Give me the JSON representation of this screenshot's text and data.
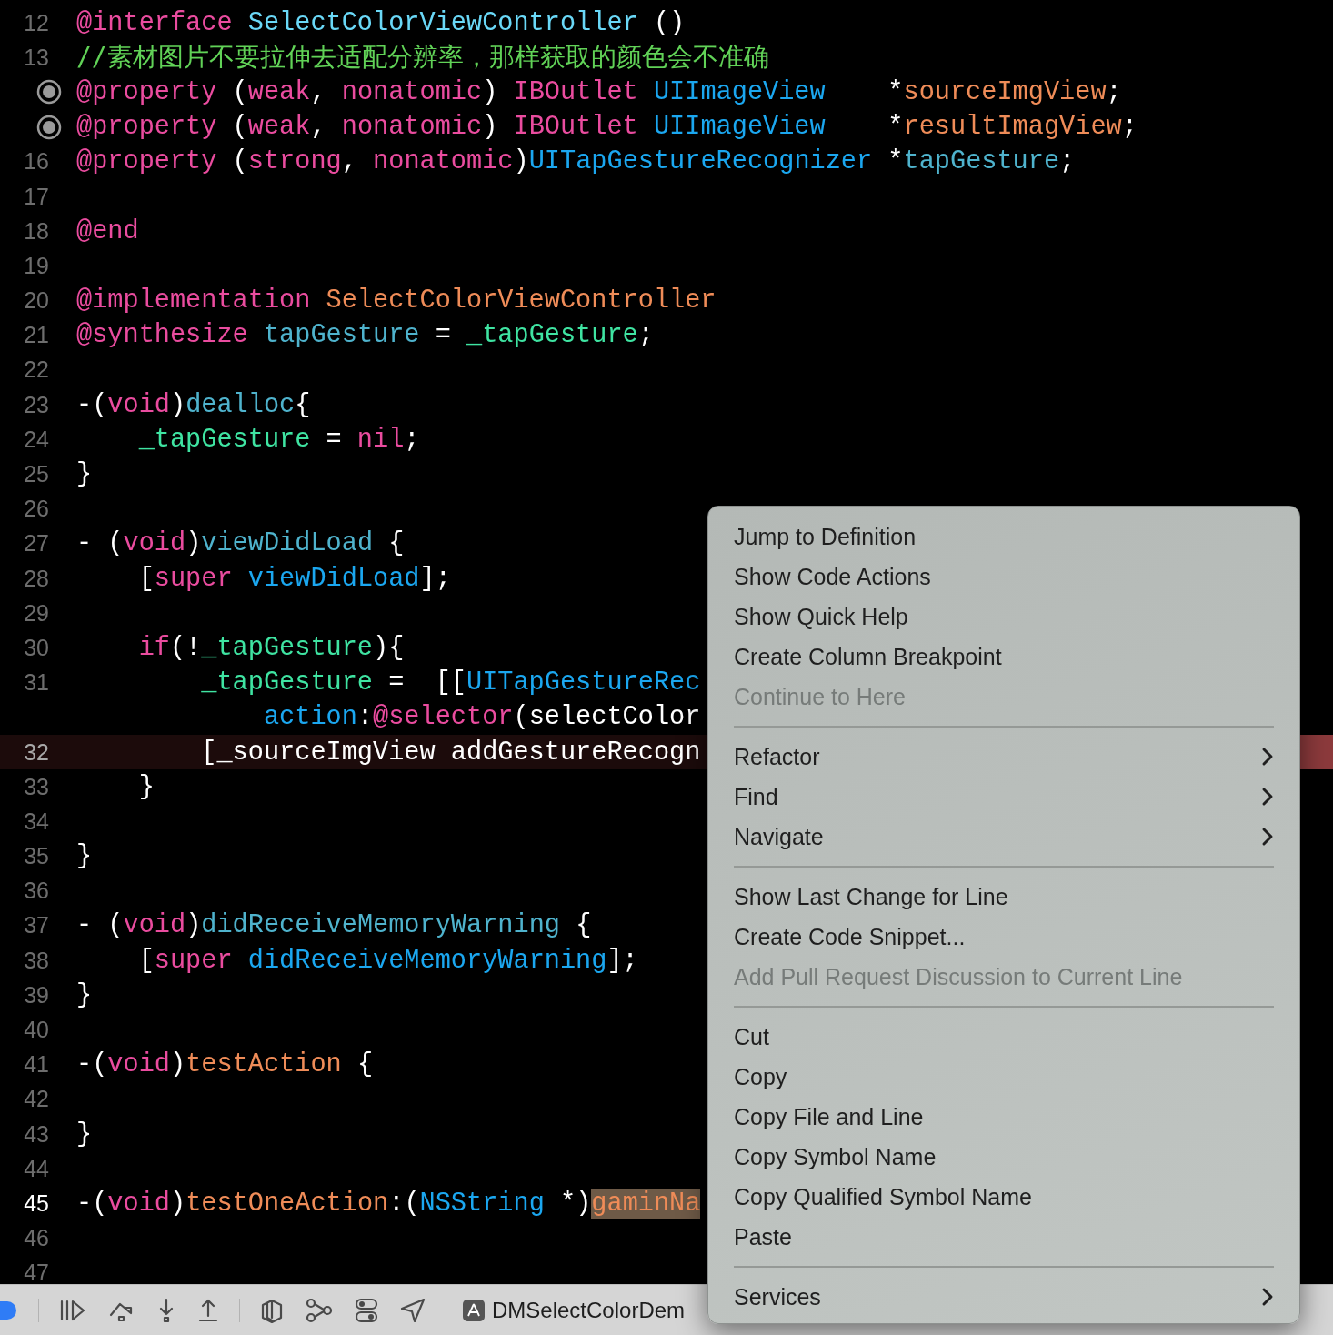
{
  "editor": {
    "lines": [
      {
        "number": "12",
        "kind": "normal",
        "tokens": [
          {
            "text": "@interface ",
            "kind": "kw"
          },
          {
            "text": "SelectColorViewController",
            "kind": "cls"
          },
          {
            "text": " ()",
            "kind": "plain"
          }
        ]
      },
      {
        "number": "13",
        "kind": "normal",
        "tokens": [
          {
            "text": "//素材图片不要拉伸去适配分辨率，那样获取的颜色会不准确",
            "kind": "comment"
          }
        ]
      },
      {
        "kind": "outlet",
        "tokens": [
          {
            "text": "@property",
            "kind": "kw"
          },
          {
            "text": " (",
            "kind": "plain"
          },
          {
            "text": "weak",
            "kind": "kw"
          },
          {
            "text": ", ",
            "kind": "plain"
          },
          {
            "text": "nonatomic",
            "kind": "kw"
          },
          {
            "text": ") ",
            "kind": "plain"
          },
          {
            "text": "IBOutlet ",
            "kind": "kw"
          },
          {
            "text": "UIImageView",
            "kind": "type"
          },
          {
            "text": "    *",
            "kind": "plain"
          },
          {
            "text": "sourceImgView",
            "kind": "decl"
          },
          {
            "text": ";",
            "kind": "plain"
          }
        ]
      },
      {
        "kind": "outlet",
        "tokens": [
          {
            "text": "@property",
            "kind": "kw"
          },
          {
            "text": " (",
            "kind": "plain"
          },
          {
            "text": "weak",
            "kind": "kw"
          },
          {
            "text": ", ",
            "kind": "plain"
          },
          {
            "text": "nonatomic",
            "kind": "kw"
          },
          {
            "text": ") ",
            "kind": "plain"
          },
          {
            "text": "IBOutlet ",
            "kind": "kw"
          },
          {
            "text": "UIImageView",
            "kind": "type"
          },
          {
            "text": "    *",
            "kind": "plain"
          },
          {
            "text": "resultImagView",
            "kind": "decl"
          },
          {
            "text": ";",
            "kind": "plain"
          }
        ]
      },
      {
        "number": "16",
        "kind": "normal",
        "tokens": [
          {
            "text": "@property",
            "kind": "kw"
          },
          {
            "text": " (",
            "kind": "plain"
          },
          {
            "text": "strong",
            "kind": "kw"
          },
          {
            "text": ", ",
            "kind": "plain"
          },
          {
            "text": "nonatomic",
            "kind": "kw"
          },
          {
            "text": ")",
            "kind": "plain"
          },
          {
            "text": "UITapGestureRecognizer",
            "kind": "type"
          },
          {
            "text": " *",
            "kind": "plain"
          },
          {
            "text": "tapGesture",
            "kind": "prop"
          },
          {
            "text": ";",
            "kind": "plain"
          }
        ]
      },
      {
        "number": "17",
        "kind": "normal"
      },
      {
        "number": "18",
        "kind": "normal",
        "tokens": [
          {
            "text": "@end",
            "kind": "kw"
          }
        ]
      },
      {
        "number": "19",
        "kind": "normal"
      },
      {
        "number": "20",
        "kind": "normal",
        "tokens": [
          {
            "text": "@implementation ",
            "kind": "kw"
          },
          {
            "text": "SelectColorViewController",
            "kind": "decl"
          }
        ]
      },
      {
        "number": "21",
        "kind": "normal",
        "tokens": [
          {
            "text": "@synthesize ",
            "kind": "kw"
          },
          {
            "text": "tapGesture",
            "kind": "prop"
          },
          {
            "text": " = ",
            "kind": "plain"
          },
          {
            "text": "_tapGesture",
            "kind": "ivar"
          },
          {
            "text": ";",
            "kind": "plain"
          }
        ]
      },
      {
        "number": "22",
        "kind": "normal"
      },
      {
        "number": "23",
        "kind": "normal",
        "tokens": [
          {
            "text": "-(",
            "kind": "plain"
          },
          {
            "text": "void",
            "kind": "kw"
          },
          {
            "text": ")",
            "kind": "plain"
          },
          {
            "text": "dealloc",
            "kind": "prop"
          },
          {
            "text": "{",
            "kind": "plain"
          }
        ]
      },
      {
        "number": "24",
        "kind": "normal",
        "tokens": [
          {
            "text": "    _tapGesture",
            "kind": "ivar"
          },
          {
            "text": " = ",
            "kind": "plain"
          },
          {
            "text": "nil",
            "kind": "kw"
          },
          {
            "text": ";",
            "kind": "plain"
          }
        ]
      },
      {
        "number": "25",
        "kind": "normal",
        "tokens": [
          {
            "text": "}",
            "kind": "plain"
          }
        ]
      },
      {
        "number": "26",
        "kind": "normal"
      },
      {
        "number": "27",
        "kind": "normal",
        "tokens": [
          {
            "text": "- (",
            "kind": "plain"
          },
          {
            "text": "void",
            "kind": "kw"
          },
          {
            "text": ")",
            "kind": "plain"
          },
          {
            "text": "viewDidLoad",
            "kind": "prop"
          },
          {
            "text": " {",
            "kind": "plain"
          }
        ]
      },
      {
        "number": "28",
        "kind": "normal",
        "tokens": [
          {
            "text": "    [",
            "kind": "plain"
          },
          {
            "text": "super ",
            "kind": "kw"
          },
          {
            "text": "viewDidLoad",
            "kind": "type"
          },
          {
            "text": "];",
            "kind": "plain"
          }
        ]
      },
      {
        "number": "29",
        "kind": "normal"
      },
      {
        "number": "30",
        "kind": "normal",
        "tokens": [
          {
            "text": "    if",
            "kind": "kw"
          },
          {
            "text": "(!",
            "kind": "plain"
          },
          {
            "text": "_tapGesture",
            "kind": "ivar"
          },
          {
            "text": "){",
            "kind": "plain"
          }
        ]
      },
      {
        "number": "31",
        "kind": "normal",
        "tokens": [
          {
            "text": "        _tapGesture",
            "kind": "ivar"
          },
          {
            "text": " =  [[",
            "kind": "plain"
          },
          {
            "text": "UITapGestureRec",
            "kind": "type"
          }
        ]
      },
      {
        "kind": "wrap",
        "tokens": [
          {
            "text": "            action",
            "kind": "type"
          },
          {
            "text": ":",
            "kind": "plain"
          },
          {
            "text": "@selector",
            "kind": "kw"
          },
          {
            "text": "(selectColor",
            "kind": "plain"
          }
        ]
      },
      {
        "number": "32",
        "kind": "highlighted",
        "tokens": [
          {
            "text": "        [_sourceImgView addGestureRecogn",
            "kind": "plain"
          }
        ]
      },
      {
        "number": "33",
        "kind": "normal",
        "tokens": [
          {
            "text": "    }",
            "kind": "plain"
          }
        ]
      },
      {
        "number": "34",
        "kind": "normal"
      },
      {
        "number": "35",
        "kind": "normal",
        "tokens": [
          {
            "text": "}",
            "kind": "plain"
          }
        ]
      },
      {
        "number": "36",
        "kind": "normal"
      },
      {
        "number": "37",
        "kind": "normal",
        "tokens": [
          {
            "text": "- (",
            "kind": "plain"
          },
          {
            "text": "void",
            "kind": "kw"
          },
          {
            "text": ")",
            "kind": "plain"
          },
          {
            "text": "didReceiveMemoryWarning",
            "kind": "prop"
          },
          {
            "text": " {",
            "kind": "plain"
          }
        ]
      },
      {
        "number": "38",
        "kind": "normal",
        "tokens": [
          {
            "text": "    [",
            "kind": "plain"
          },
          {
            "text": "super ",
            "kind": "kw"
          },
          {
            "text": "didReceiveMemoryWarning",
            "kind": "type"
          },
          {
            "text": "];",
            "kind": "plain"
          }
        ]
      },
      {
        "number": "39",
        "kind": "normal",
        "tokens": [
          {
            "text": "}",
            "kind": "plain"
          }
        ]
      },
      {
        "number": "40",
        "kind": "normal"
      },
      {
        "number": "41",
        "kind": "normal",
        "tokens": [
          {
            "text": "-(",
            "kind": "plain"
          },
          {
            "text": "void",
            "kind": "kw"
          },
          {
            "text": ")",
            "kind": "plain"
          },
          {
            "text": "testAction",
            "kind": "decl"
          },
          {
            "text": " {",
            "kind": "plain"
          }
        ]
      },
      {
        "number": "42",
        "kind": "normal"
      },
      {
        "number": "43",
        "kind": "normal",
        "tokens": [
          {
            "text": "}",
            "kind": "plain"
          }
        ]
      },
      {
        "number": "44",
        "kind": "normal"
      },
      {
        "number": "45",
        "kind": "current",
        "tokens": [
          {
            "text": "-(",
            "kind": "plain"
          },
          {
            "text": "void",
            "kind": "kw"
          },
          {
            "text": ")",
            "kind": "plain"
          },
          {
            "text": "testOneAction",
            "kind": "decl"
          },
          {
            "text": ":(",
            "kind": "plain"
          },
          {
            "text": "NSString",
            "kind": "type"
          },
          {
            "text": " *)",
            "kind": "plain"
          },
          {
            "text": "gaminNa",
            "kind": "match"
          }
        ]
      },
      {
        "number": "46",
        "kind": "normal"
      },
      {
        "number": "47",
        "kind": "normal"
      }
    ]
  },
  "debug_bar": {
    "scheme": "DMSelectColorDem"
  },
  "context_menu": {
    "items": [
      {
        "label": "Jump to Definition",
        "kind": "item"
      },
      {
        "label": "Show Code Actions",
        "kind": "item"
      },
      {
        "label": "Show Quick Help",
        "kind": "item"
      },
      {
        "label": "Create Column Breakpoint",
        "kind": "item"
      },
      {
        "label": "Continue to Here",
        "kind": "disabled"
      },
      {
        "kind": "separator"
      },
      {
        "label": "Refactor",
        "kind": "submenu"
      },
      {
        "label": "Find",
        "kind": "submenu"
      },
      {
        "label": "Navigate",
        "kind": "submenu"
      },
      {
        "kind": "separator"
      },
      {
        "label": "Show Last Change for Line",
        "kind": "item"
      },
      {
        "label": "Create Code Snippet...",
        "kind": "item"
      },
      {
        "label": "Add Pull Request Discussion to Current Line",
        "kind": "disabled"
      },
      {
        "kind": "separator"
      },
      {
        "label": "Cut",
        "kind": "item"
      },
      {
        "label": "Copy",
        "kind": "item"
      },
      {
        "label": "Copy File and Line",
        "kind": "item"
      },
      {
        "label": "Copy Symbol Name",
        "kind": "item"
      },
      {
        "label": "Copy Qualified Symbol Name",
        "kind": "item"
      },
      {
        "label": "Paste",
        "kind": "item"
      },
      {
        "kind": "separator"
      },
      {
        "label": "Services",
        "kind": "submenu"
      }
    ]
  }
}
